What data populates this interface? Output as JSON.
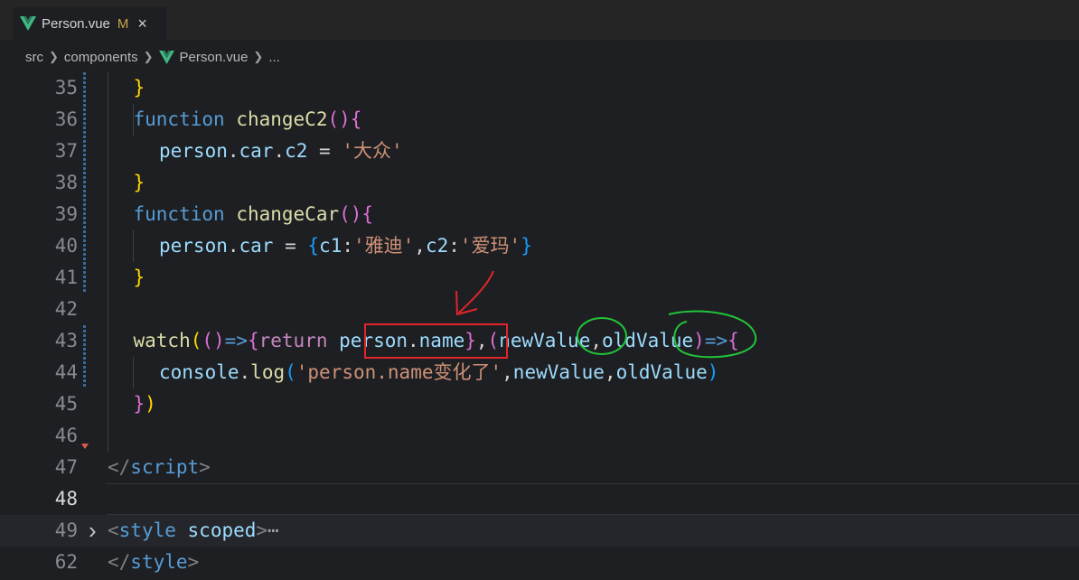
{
  "tab": {
    "title": "Person.vue",
    "modified": "M",
    "close": "×"
  },
  "breadcrumb": {
    "items": [
      "src",
      "components",
      "Person.vue",
      "..."
    ]
  },
  "editor": {
    "current_line": "48",
    "lines": [
      {
        "num": "35",
        "segments": [
          [
            "}",
            "br1"
          ]
        ],
        "indent": 1
      },
      {
        "num": "36",
        "segments": [
          [
            "function",
            "kw"
          ],
          [
            " ",
            "pl"
          ],
          [
            "changeC2",
            "fn"
          ],
          [
            "()",
            "br2"
          ],
          [
            "{",
            "br2"
          ]
        ],
        "indent": 1
      },
      {
        "num": "37",
        "segments": [
          [
            "person",
            "var"
          ],
          [
            ".",
            "pl"
          ],
          [
            "car",
            "var"
          ],
          [
            ".",
            "pl"
          ],
          [
            "c2",
            "var"
          ],
          [
            " = ",
            "pl"
          ],
          [
            "'大众'",
            "str"
          ]
        ],
        "indent": 2
      },
      {
        "num": "38",
        "segments": [
          [
            "}",
            "br1"
          ]
        ],
        "indent": 1
      },
      {
        "num": "39",
        "segments": [
          [
            "function",
            "kw"
          ],
          [
            " ",
            "pl"
          ],
          [
            "changeCar",
            "fn"
          ],
          [
            "()",
            "br2"
          ],
          [
            "{",
            "br2"
          ]
        ],
        "indent": 1
      },
      {
        "num": "40",
        "segments": [
          [
            "person",
            "var"
          ],
          [
            ".",
            "pl"
          ],
          [
            "car",
            "var"
          ],
          [
            " = ",
            "pl"
          ],
          [
            "{",
            "br3"
          ],
          [
            "c1",
            "var"
          ],
          [
            ":",
            "pl"
          ],
          [
            "'雅迪'",
            "str"
          ],
          [
            ",",
            "pl"
          ],
          [
            "c2",
            "var"
          ],
          [
            ":",
            "pl"
          ],
          [
            "'爱玛'",
            "str"
          ],
          [
            "}",
            "br3"
          ]
        ],
        "indent": 2
      },
      {
        "num": "41",
        "segments": [
          [
            "}",
            "br1"
          ]
        ],
        "indent": 1
      },
      {
        "num": "42",
        "segments": [],
        "indent": 0
      },
      {
        "num": "43",
        "segments": [
          [
            "watch",
            "fn"
          ],
          [
            "(",
            "br1"
          ],
          [
            "()",
            "br2"
          ],
          [
            "=>",
            "kw"
          ],
          [
            "{",
            "br2"
          ],
          [
            "return",
            "kwp"
          ],
          [
            " ",
            "pl"
          ],
          [
            "person",
            "var"
          ],
          [
            ".",
            "pl"
          ],
          [
            "name",
            "var"
          ],
          [
            "}",
            "br2"
          ],
          [
            ",",
            "pl"
          ],
          [
            "(",
            "br2"
          ],
          [
            "newValue",
            "var"
          ],
          [
            ",",
            "pl"
          ],
          [
            "oldValue",
            "var"
          ],
          [
            ")",
            "br2"
          ],
          [
            "=>",
            "kw"
          ],
          [
            "{",
            "br2"
          ]
        ],
        "indent": 1
      },
      {
        "num": "44",
        "segments": [
          [
            "console",
            "var"
          ],
          [
            ".",
            "pl"
          ],
          [
            "log",
            "fn"
          ],
          [
            "(",
            "br3"
          ],
          [
            "'person.name变化了'",
            "str"
          ],
          [
            ",",
            "pl"
          ],
          [
            "newValue",
            "var"
          ],
          [
            ",",
            "pl"
          ],
          [
            "oldValue",
            "var"
          ],
          [
            ")",
            "br3"
          ]
        ],
        "indent": 2
      },
      {
        "num": "45",
        "segments": [
          [
            "}",
            "br2"
          ],
          [
            ")",
            "br1"
          ]
        ],
        "indent": 1
      },
      {
        "num": "46",
        "segments": [],
        "indent": 0
      },
      {
        "num": "47",
        "segments": [
          [
            "</",
            "tagp"
          ],
          [
            "script",
            "tagn"
          ],
          [
            ">",
            "tagp"
          ]
        ],
        "indent": 0
      },
      {
        "num": "48",
        "segments": [],
        "indent": 0
      },
      {
        "num": "49",
        "segments": [
          [
            "<",
            "tagp"
          ],
          [
            "style",
            "tagn"
          ],
          [
            " ",
            "pl"
          ],
          [
            "scoped",
            "attr"
          ],
          [
            ">",
            "tagp"
          ],
          [
            "⋯",
            "ell"
          ]
        ],
        "indent": 0
      },
      {
        "num": "62",
        "segments": [
          [
            "</",
            "tagp"
          ],
          [
            "style",
            "tagn"
          ],
          [
            ">",
            "tagp"
          ]
        ],
        "indent": 0
      }
    ]
  },
  "icons": {
    "vue": "vue-icon",
    "fold": "chevron-right-icon",
    "chevron": "chevron-right-icon"
  },
  "colors": {
    "keyword": "#569cd6",
    "function": "#dcdcaa",
    "variable": "#9cdcfe",
    "string": "#ce9178",
    "annotation_red": "#e0262a",
    "annotation_green": "#21c43a"
  }
}
